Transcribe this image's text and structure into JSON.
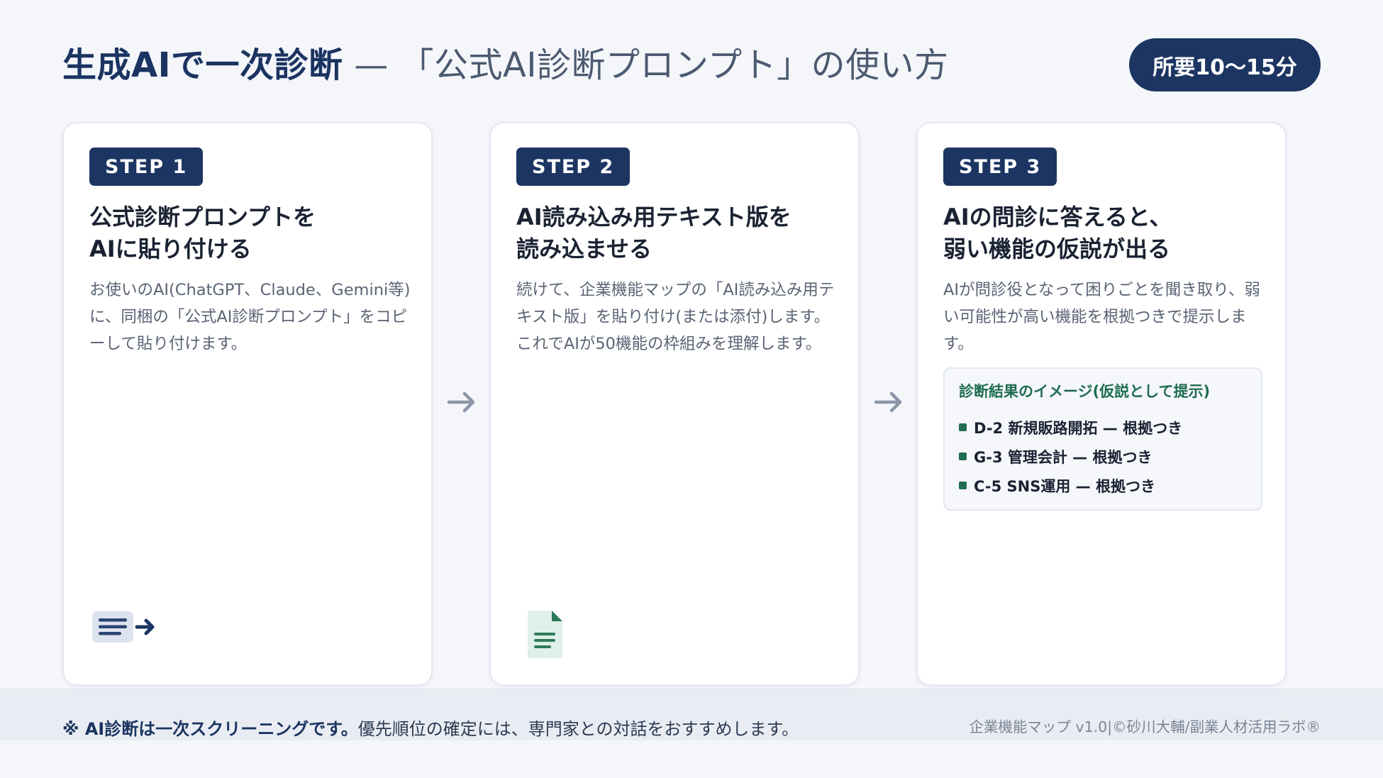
{
  "header": {
    "title_strong": "生成AIで一次診断",
    "title_rest": " — 「公式AI診断プロンプト」の使い方",
    "duration": "所要10〜15分"
  },
  "steps": [
    {
      "badge": "STEP 1",
      "title_line1": "公式診断プロンプトを",
      "title_line2": "AIに貼り付ける",
      "description": "お使いのAI(ChatGPT、Claude、Gemini等)に、同梱の「公式AI診断プロンプト」をコピーして貼り付けます。",
      "icon": "copy-paste-icon"
    },
    {
      "badge": "STEP 2",
      "title_line1": "AI読み込み用テキスト版を",
      "title_line2": "読み込ませる",
      "description": "続けて、企業機能マップの「AI読み込み用テキスト版」を貼り付け(または添付)します。これでAIが50機能の枠組みを理解します。",
      "icon": "document-icon"
    },
    {
      "badge": "STEP 3",
      "title_line1": "AIの問診に答えると、",
      "title_line2": "弱い機能の仮説が出る",
      "description": "AIが問診役となって困りごとを聞き取り、弱い可能性が高い機能を根拠つきで提示します。"
    }
  ],
  "result": {
    "title": "診断結果のイメージ(仮説として提示)",
    "items": [
      "D-2 新規販路開拓 — 根拠つき",
      "G-3 管理会計 — 根拠つき",
      "C-5 SNS運用 — 根拠つき"
    ]
  },
  "footer": {
    "note_strong": "※ AI診断は一次スクリーニングです。",
    "note_rest": "優先順位の確定には、専門家との対話をおすすめします。",
    "credit": "企業機能マップ v1.0|©砂川大輔/副業人材活用ラボ®"
  },
  "colors": {
    "navy": "#1c3562",
    "accent_green": "#1f6c52",
    "background": "#f4f6fa"
  },
  "icons": [
    "arrow-right-icon",
    "copy-paste-icon",
    "document-icon",
    "bullet-icon"
  ]
}
